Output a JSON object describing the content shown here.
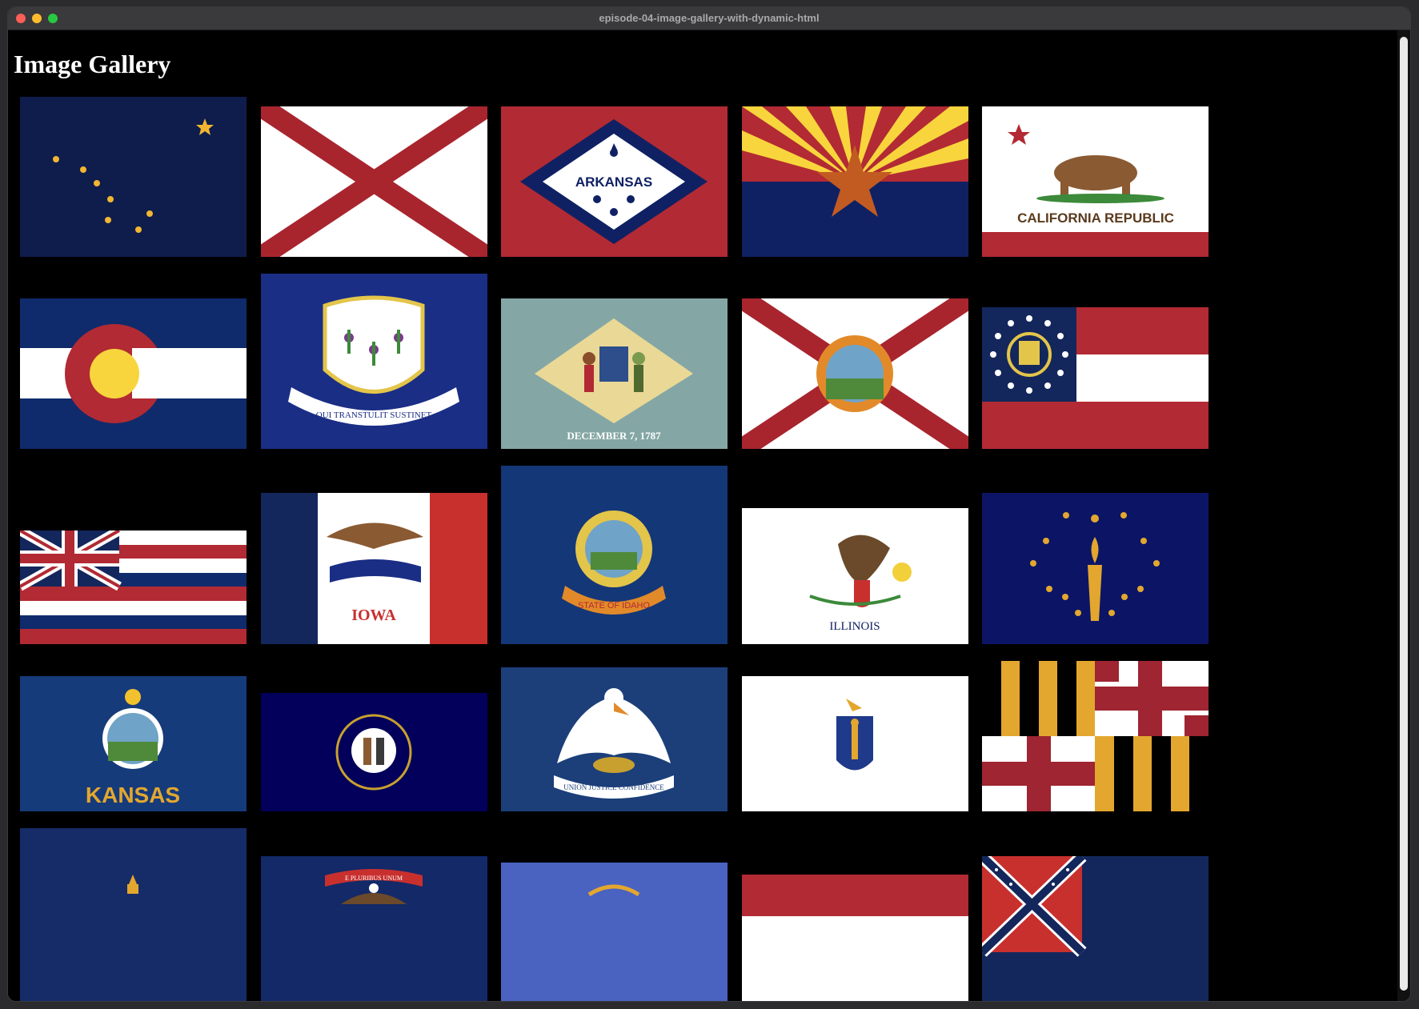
{
  "window": {
    "title": "episode-04-image-gallery-with-dynamic-html"
  },
  "page": {
    "title": "Image Gallery"
  },
  "gallery": {
    "flags": [
      {
        "state": "Alaska"
      },
      {
        "state": "Alabama"
      },
      {
        "state": "Arkansas",
        "text": "ARKANSAS"
      },
      {
        "state": "Arizona"
      },
      {
        "state": "California",
        "text": "CALIFORNIA  REPUBLIC"
      },
      {
        "state": "Colorado"
      },
      {
        "state": "Connecticut",
        "text": "QUI TRANSTULIT SUSTINET"
      },
      {
        "state": "Delaware",
        "text": "DECEMBER 7, 1787"
      },
      {
        "state": "Florida"
      },
      {
        "state": "Georgia"
      },
      {
        "state": "Hawaii"
      },
      {
        "state": "Iowa",
        "text": "IOWA"
      },
      {
        "state": "Idaho",
        "text": "STATE OF IDAHO"
      },
      {
        "state": "Illinois",
        "text": "ILLINOIS"
      },
      {
        "state": "Indiana"
      },
      {
        "state": "Kansas",
        "text": "KANSAS"
      },
      {
        "state": "Kentucky"
      },
      {
        "state": "Louisiana",
        "text": "UNION JUSTICE CONFIDENCE"
      },
      {
        "state": "Massachusetts"
      },
      {
        "state": "Maryland"
      },
      {
        "state": "Maine"
      },
      {
        "state": "Michigan",
        "text": "E PLURIBUS UNUM"
      },
      {
        "state": "Minnesota"
      },
      {
        "state": "Missouri"
      },
      {
        "state": "Mississippi"
      }
    ]
  },
  "colors": {
    "background": "#000000",
    "title": "#ffffff"
  }
}
